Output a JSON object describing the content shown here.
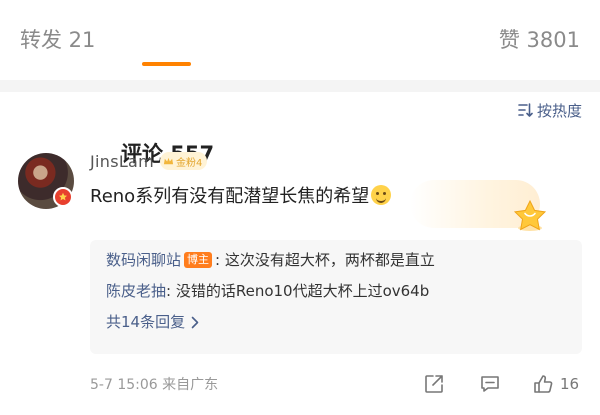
{
  "tabs": {
    "repost": "转发 21",
    "comments": "评论 557",
    "likes": "赞 3801"
  },
  "sort": {
    "label": "按热度"
  },
  "comment": {
    "username": "JinsLam",
    "fan_badge": "金粉4",
    "text": "Reno系列有没有配潜望长焦的希望",
    "emoji_icon": "doge-emoji",
    "replies": [
      {
        "name": "数码闲聊站",
        "tag": "博主",
        "text": ": 这次没有超大杯，两杯都是直立"
      },
      {
        "name": "陈皮老抽",
        "text": ": 没错的话Reno10代超大杯上过ov64b"
      }
    ],
    "more_replies": "共14条回复",
    "meta": "5-7 15:06  来自广东",
    "like_count": "16"
  },
  "colors": {
    "accent": "#ff8200",
    "link": "#4a5f8a",
    "badge": "#ff7d1d"
  }
}
